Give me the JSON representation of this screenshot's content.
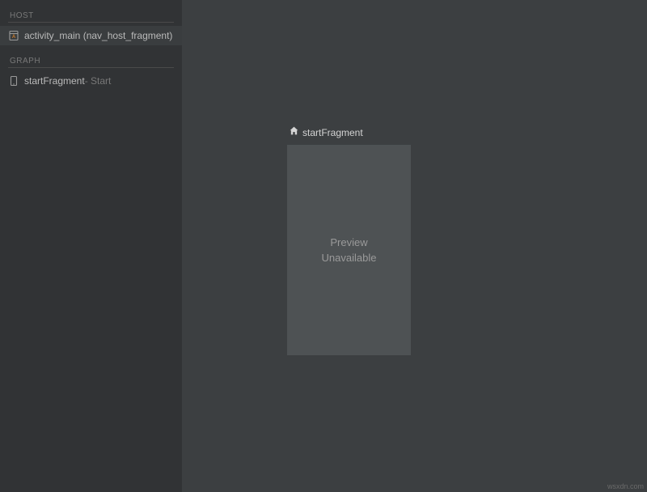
{
  "sidebar": {
    "host_section_label": "HOST",
    "host_item_label": "activity_main (nav_host_fragment)",
    "graph_section_label": "GRAPH",
    "graph_item_label": "startFragment",
    "graph_item_suffix": " - Start"
  },
  "canvas": {
    "destination_title": "startFragment",
    "preview_line1": "Preview",
    "preview_line2": "Unavailable"
  },
  "watermark": "wsxdn.com"
}
